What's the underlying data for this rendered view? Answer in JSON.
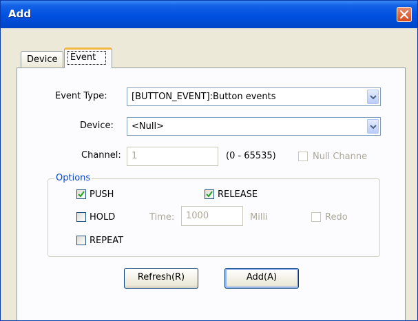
{
  "window": {
    "title": "Add"
  },
  "tabs": [
    {
      "label": "Device",
      "selected": false
    },
    {
      "label": "Event",
      "selected": true
    }
  ],
  "form": {
    "event_type": {
      "label": "Event Type:",
      "value": "[BUTTON_EVENT]:Button events"
    },
    "device": {
      "label": "Device:",
      "value": "<Null>"
    },
    "channel": {
      "label": "Channel:",
      "value": "1",
      "range": "(0 - 65535)",
      "null_channel_label": "Null Channe",
      "null_channel_checked": false
    }
  },
  "options": {
    "title": "Options",
    "push": {
      "label": "PUSH",
      "checked": true
    },
    "release": {
      "label": "RELEASE",
      "checked": true
    },
    "hold": {
      "label": "HOLD",
      "checked": false
    },
    "time": {
      "label": "Time:",
      "value": "1000",
      "unit": "Milli"
    },
    "redo": {
      "label": "Redo",
      "checked": false
    },
    "repeat": {
      "label": "REPEAT",
      "checked": false
    }
  },
  "buttons": {
    "refresh": "Refresh(R)",
    "add": "Add(A)"
  },
  "colors": {
    "title_bar": "#0050e0",
    "close_button": "#d44a1c",
    "tab_highlight": "#f5b33f",
    "group_title": "#0046d5"
  }
}
